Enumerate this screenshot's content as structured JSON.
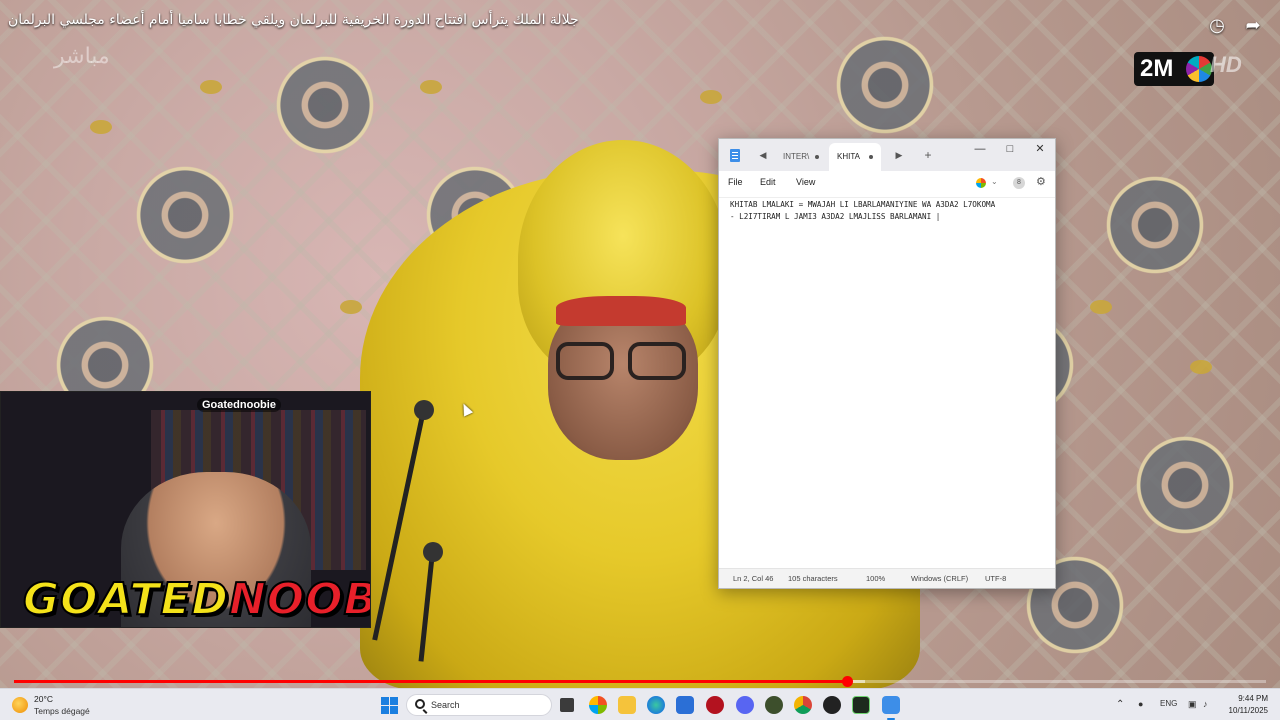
{
  "video": {
    "title": "جلالة الملك يترأس افتتاح الدورة الخريفية للبرلمان ويلقي خطابا ساميا أمام أعضاء مجلسي البرلمان",
    "watermark": "مباشر",
    "channel_logo": "2M",
    "hd_mark": "HD",
    "progress": 0.665,
    "buffered": 0.68
  },
  "webcam": {
    "tag": "Goatednoobie",
    "brand_part1": "GOATED",
    "brand_part2": "NOOBIE",
    "colors": {
      "part1": "#f4e21a",
      "part2": "#e8202a"
    }
  },
  "notepad": {
    "tabs": [
      {
        "label": "INTER\\",
        "active": false
      },
      {
        "label": "KHITA",
        "active": true
      }
    ],
    "menu": [
      "File",
      "Edit",
      "View"
    ],
    "account_initial": "8",
    "content": "KHITAB LMALAKI = MWAJAH LI LBARLAMANIYINE WA A3DA2 L7OKOMA\n- L2I7TIRAM L JAMI3 A3DA2 LMAJLISS BARLAMANI |",
    "status": {
      "position": "Ln 2, Col 46",
      "characters": "105 characters",
      "zoom": "100%",
      "line_endings": "Windows (CRLF)",
      "encoding": "UTF-8"
    }
  },
  "taskbar": {
    "weather_temp": "20°C",
    "weather_condition": "Temps dégagé",
    "search_placeholder": "Search",
    "language": "ENG",
    "time": "9:44 PM",
    "date": "10/11/2025"
  }
}
